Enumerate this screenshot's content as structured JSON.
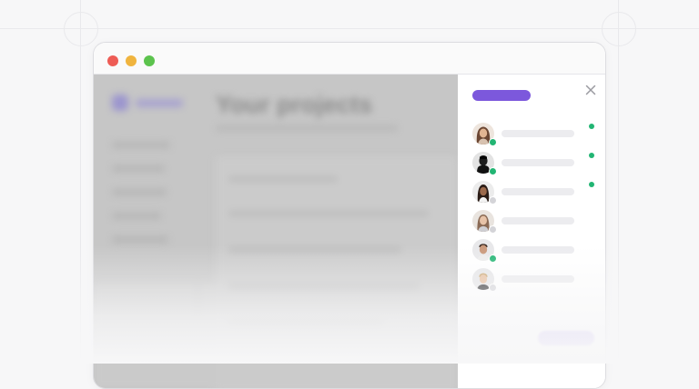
{
  "window": {
    "controls": [
      {
        "name": "close",
        "color": "#ee5c55"
      },
      {
        "name": "minimize",
        "color": "#f0b43e"
      },
      {
        "name": "maximize",
        "color": "#5cc34d"
      }
    ]
  },
  "background_app": {
    "page_title": "Your projects"
  },
  "panel": {
    "title": "",
    "close_icon": "close-icon",
    "accent_color": "#7c58dc",
    "members": [
      {
        "name": "",
        "presence": "online",
        "status_indicator": true
      },
      {
        "name": "",
        "presence": "online",
        "status_indicator": true
      },
      {
        "name": "",
        "presence": "offline",
        "status_indicator": true
      },
      {
        "name": "",
        "presence": "offline",
        "status_indicator": false
      },
      {
        "name": "",
        "presence": "online",
        "status_indicator": false
      },
      {
        "name": "",
        "presence": "offline",
        "status_indicator": false
      }
    ],
    "action_button_label": ""
  }
}
